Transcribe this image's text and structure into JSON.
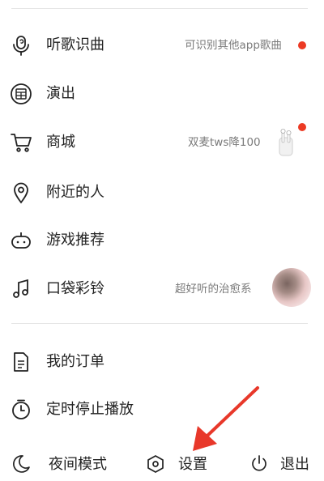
{
  "menu": {
    "items": [
      {
        "label": "听歌识曲",
        "subtitle": "可识别其他app歌曲",
        "icon": "microphone-icon",
        "badge": true
      },
      {
        "label": "演出",
        "icon": "ticket-icon"
      },
      {
        "label": "商城",
        "subtitle": "双麦tws降100",
        "icon": "shopping-cart-icon",
        "thumbnail": "earbuds-product",
        "badge": true
      },
      {
        "label": "附近的人",
        "icon": "location-pin-icon"
      },
      {
        "label": "游戏推荐",
        "icon": "gamepad-icon"
      },
      {
        "label": "口袋彩铃",
        "subtitle": "超好听的治愈系",
        "icon": "music-note-icon",
        "thumbnail": "avatar-blurred"
      }
    ],
    "secondary_items": [
      {
        "label": "我的订单",
        "icon": "document-icon"
      },
      {
        "label": "定时停止播放",
        "icon": "timer-icon"
      }
    ]
  },
  "bottom_bar": {
    "night_mode": {
      "label": "夜间模式",
      "icon": "moon-icon"
    },
    "settings": {
      "label": "设置",
      "icon": "hexagon-settings-icon"
    },
    "logout": {
      "label": "退出",
      "icon": "power-icon"
    }
  },
  "colors": {
    "badge": "#ec3a24",
    "annotation_arrow": "#e8382a",
    "text": "#222222",
    "subtext": "#7a7a7a"
  }
}
